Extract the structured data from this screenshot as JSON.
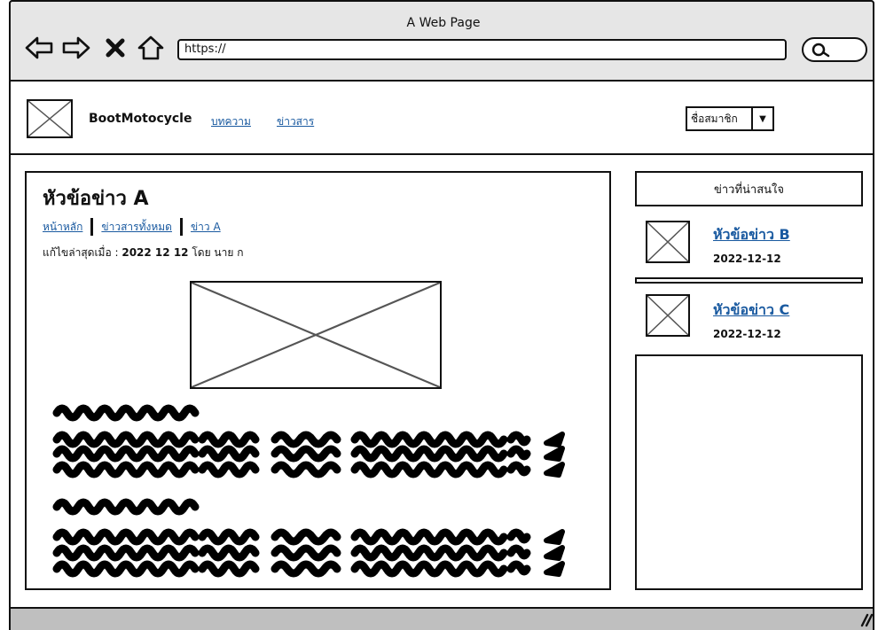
{
  "window": {
    "title": "A Web Page"
  },
  "browser": {
    "url": "https://",
    "nav_icons": [
      "back-arrow-icon",
      "forward-arrow-icon",
      "stop-x-icon",
      "home-icon"
    ],
    "search_icon": "search-icon"
  },
  "header": {
    "brand": "BootMotocycle",
    "nav": [
      {
        "label": "บทความ"
      },
      {
        "label": "ข่าวสาร"
      }
    ],
    "member_select": {
      "value": "ชื่อสมาชิก"
    }
  },
  "article": {
    "title": "หัวข้อข่าว A",
    "breadcrumb": [
      {
        "label": "หน้าหลัก"
      },
      {
        "label": "ข่าวสารทั้งหมด"
      },
      {
        "label": "ข่าว A"
      }
    ],
    "meta": {
      "prefix": "แก้ไขล่าสุดเมื่อ :",
      "date": "2022 12 12",
      "by": "โดย นาย ก"
    }
  },
  "sidebar": {
    "title": "ข่าวที่น่าสนใจ",
    "items": [
      {
        "title": "หัวข้อข่าว B",
        "date": "2022-12-12"
      },
      {
        "title": "หัวข้อข่าว C",
        "date": "2022-12-12"
      }
    ]
  },
  "colors": {
    "link": "#1a5aa0",
    "chrome": "#e6e6e6",
    "status_bar": "#bfbfbf"
  }
}
